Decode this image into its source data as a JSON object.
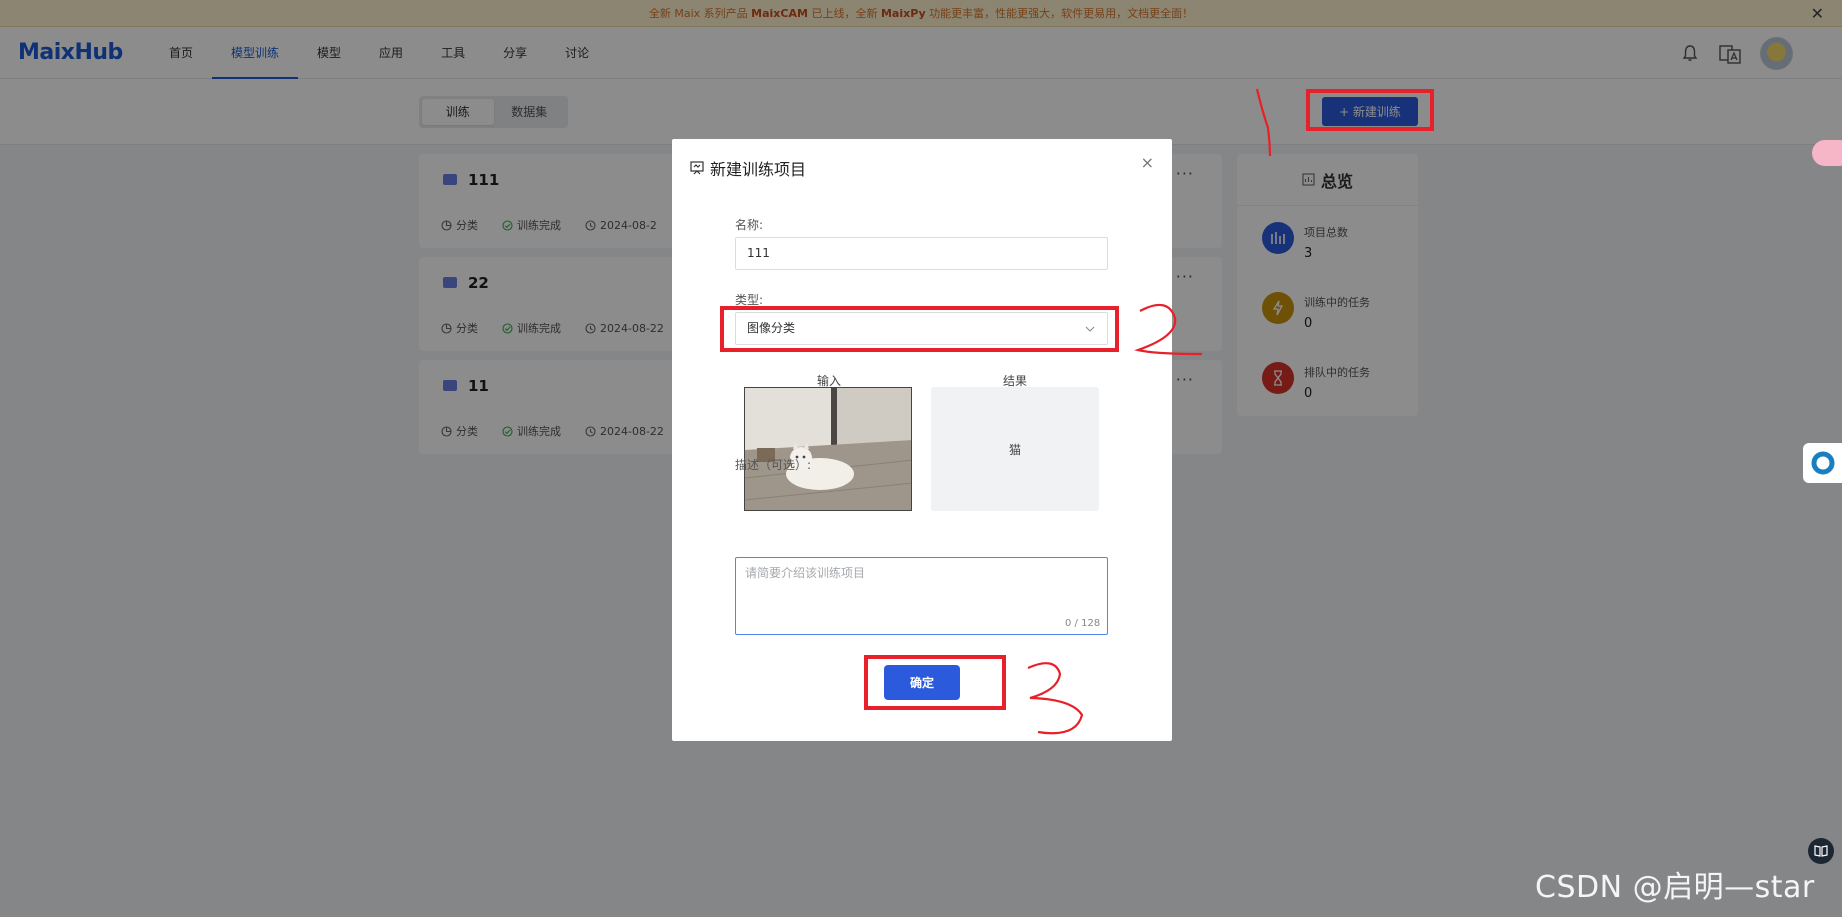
{
  "banner": {
    "prefix": "全新 Maix 系列产品",
    "product1": "MaixCAM",
    "middle": "已上线，全新",
    "product2": "MaixPy",
    "suffix": "功能更丰富，性能更强大，软件更易用，文档更全面！",
    "close": "✕"
  },
  "header": {
    "logo": "MaixHub",
    "nav": [
      {
        "label": "首页"
      },
      {
        "label": "模型训练"
      },
      {
        "label": "模型"
      },
      {
        "label": "应用"
      },
      {
        "label": "工具"
      },
      {
        "label": "分享"
      },
      {
        "label": "讨论"
      }
    ],
    "active_nav": "模型训练"
  },
  "subbar": {
    "tabs": [
      {
        "label": "训练"
      },
      {
        "label": "数据集"
      }
    ],
    "new_button": "+ 新建训练"
  },
  "projects": [
    {
      "name": "111",
      "type": "分类",
      "status": "训练完成",
      "date": "2024-08-2",
      "more": "···"
    },
    {
      "name": "22",
      "type": "分类",
      "status": "训练完成",
      "date": "2024-08-22",
      "more": "···"
    },
    {
      "name": "11",
      "type": "分类",
      "status": "训练完成",
      "date": "2024-08-22",
      "more": "···"
    }
  ],
  "overview": {
    "title": "总览",
    "items": [
      {
        "label": "项目总数",
        "value": "3",
        "color": "#2b5bdc",
        "icon": "bar-chart-icon"
      },
      {
        "label": "训练中的任务",
        "value": "0",
        "color": "#c8920e",
        "icon": "lightning-icon"
      },
      {
        "label": "排队中的任务",
        "value": "0",
        "color": "#d9322b",
        "icon": "hourglass-icon"
      }
    ]
  },
  "modal": {
    "title": "新建训练项目",
    "close": "×",
    "name_label": "名称:",
    "name_value": "111",
    "type_label": "类型:",
    "type_value": "图像分类",
    "input_caption": "输入",
    "result_caption": "结果",
    "result_value": "猫",
    "desc_label": "描述（可选）:",
    "desc_placeholder": "请简要介绍该训练项目",
    "char_count": "0 / 128",
    "confirm": "确定"
  },
  "annotations": {
    "step1": "1",
    "step2": "2",
    "step3": "3"
  },
  "watermark": "CSDN @启明—star",
  "colors": {
    "accent": "#2b5bdc",
    "annotation_red": "#e8202a",
    "banner_bg": "#fdf2cf",
    "success": "#2fb34f"
  }
}
